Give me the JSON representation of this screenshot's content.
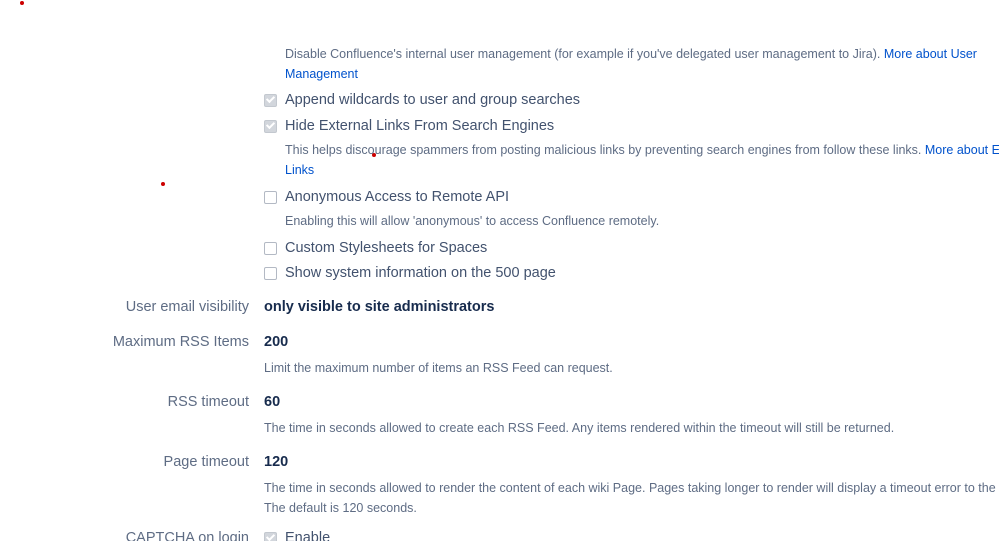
{
  "user_management": {
    "description": "Disable Confluence's internal user management (for example if you've delegated user management to Jira).",
    "link_line1": "More about User",
    "link_line2": "Management"
  },
  "checkboxes": [
    {
      "label": "Append wildcards to user and group searches",
      "checked": true
    },
    {
      "label": "Hide External Links From Search Engines",
      "checked": true
    },
    {
      "label": "Anonymous Access to Remote API",
      "checked": false
    },
    {
      "label": "Custom Stylesheets for Spaces",
      "checked": false
    },
    {
      "label": "Show system information on the 500 page",
      "checked": false
    }
  ],
  "external_links": {
    "description": "This helps discourage spammers from posting malicious links by preventing search engines from follow these links.",
    "link_line1": "More about Exter",
    "link_line2": "Links"
  },
  "remote_api": {
    "description": "Enabling this will allow 'anonymous' to access Confluence remotely."
  },
  "settings": [
    {
      "label": "User email visibility",
      "value": "only visible to site administrators",
      "description": ""
    },
    {
      "label": "Maximum RSS Items",
      "value": "200",
      "description": "Limit the maximum number of items an RSS Feed can request."
    },
    {
      "label": "RSS timeout",
      "value": "60",
      "description": "The time in seconds allowed to create each RSS Feed. Any items rendered within the timeout will still be returned."
    },
    {
      "label": "Page timeout",
      "value": "120",
      "description": "The time in seconds allowed to render the content of each wiki Page. Pages taking longer to render will display a timeout error to the use",
      "description2": "The default is 120 seconds."
    },
    {
      "label": "CAPTCHA on login",
      "value": "Enable",
      "checked": true
    }
  ],
  "colors": {
    "link": "#0052cc",
    "value": "#172b4d",
    "label": "#5e6c84",
    "annotation_dot": "#cc0000"
  }
}
